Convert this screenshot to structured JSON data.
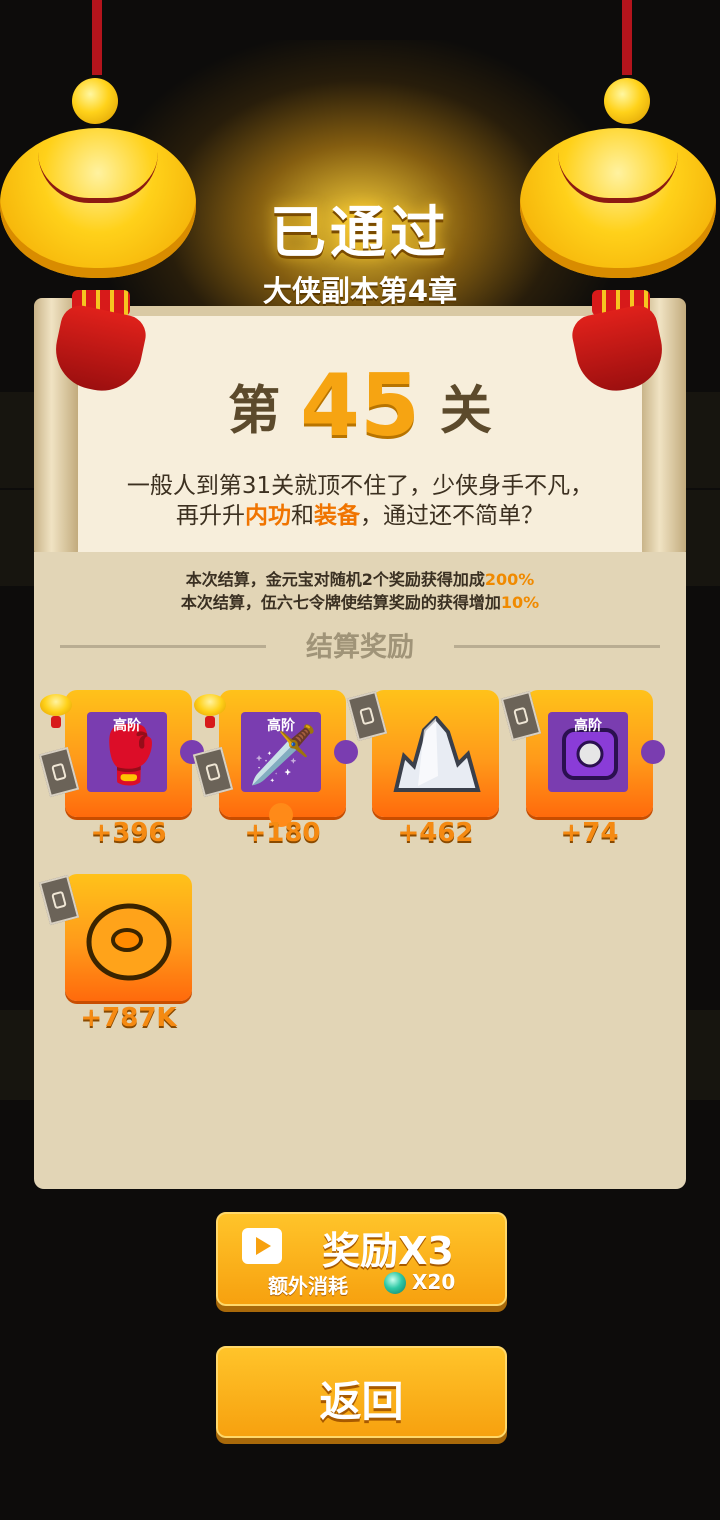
{
  "header": {
    "title": "已通过",
    "subtitle": "大侠副本第4章"
  },
  "stage": {
    "prefix": "第",
    "number": "45",
    "suffix": "关"
  },
  "description": {
    "line1": "一般人到第31关就顶不住了，少侠身手不凡，",
    "line2_pre": "再升升",
    "line2_hl1": "内功",
    "line2_mid": "和",
    "line2_hl2": "装备",
    "line2_post": "，通过还不简单？"
  },
  "bonus_info": {
    "line1_text": "本次结算，金元宝对随机2个奖励获得加成",
    "line1_pct": "200%",
    "line2_text": "本次结算，伍六七令牌使结算奖励的获得增加",
    "line2_pct": "10%"
  },
  "rewards_section": {
    "title": "结算奖励"
  },
  "rewards": [
    {
      "tier": "高阶",
      "icon": "red-glove-icon",
      "amount": "+396"
    },
    {
      "tier": "高阶",
      "icon": "sword-icon",
      "amount": "+180"
    },
    {
      "tier": "",
      "icon": "crystal-icon",
      "amount": "+462"
    },
    {
      "tier": "高阶",
      "icon": "armor-icon",
      "amount": "+74"
    },
    {
      "tier": "",
      "icon": "gold-coin-icon",
      "amount": "+787K"
    }
  ],
  "buttons": {
    "reward_x3_label": "奖励X3",
    "extra_cost_label": "额外消耗",
    "extra_cost_value": "X20",
    "back_label": "返回"
  },
  "colors": {
    "accent": "#f6a412",
    "highlight": "#f07400",
    "panel": "#e2d5b6",
    "background": "#0d0c0b"
  }
}
